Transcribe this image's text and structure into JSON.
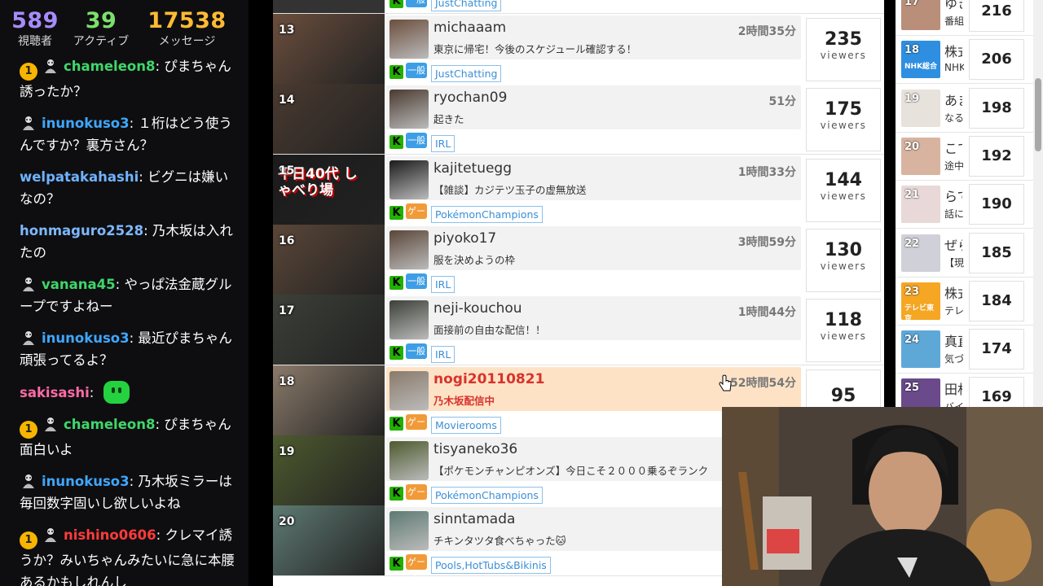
{
  "stats": [
    {
      "value": "589",
      "label": "視聴者",
      "color": "#a78bff"
    },
    {
      "value": "39",
      "label": "アクティブ",
      "color": "#7be06b"
    },
    {
      "value": "17538",
      "label": "メッセージ",
      "color": "#ffbb33"
    }
  ],
  "chat": [
    {
      "badge": "1",
      "mod": true,
      "user": "chameleon8",
      "user_color": "#3fd66b",
      "text": "ぴまちゃん誘ったか？"
    },
    {
      "badge": "",
      "mod": true,
      "user": "inunokuso3",
      "user_color": "#3fa7ff",
      "text": "１桁はどう使うんですか？裏方さん？"
    },
    {
      "badge": "",
      "mod": false,
      "user": "welpatakahashi",
      "user_color": "#6fb3ff",
      "text": "ビグニは嫌いなの？"
    },
    {
      "badge": "",
      "mod": false,
      "user": "honmaguro2528",
      "user_color": "#7db8ff",
      "text": "乃木坂は入れたの"
    },
    {
      "badge": "",
      "mod": true,
      "user": "vanana45",
      "user_color": "#3fd66b",
      "text": "やっぱ法金蔵グループですよねー"
    },
    {
      "badge": "",
      "mod": true,
      "user": "inunokuso3",
      "user_color": "#3fa7ff",
      "text": "最近ぴまちゃん頑張ってるよ？"
    },
    {
      "badge": "",
      "mod": false,
      "user": "sakisashi",
      "user_color": "#ff6ba6",
      "text": "",
      "emote": true
    },
    {
      "badge": "1",
      "mod": true,
      "user": "chameleon8",
      "user_color": "#3fd66b",
      "text": "ぴまちゃん面白いよ"
    },
    {
      "badge": "",
      "mod": true,
      "user": "inunokuso3",
      "user_color": "#3fa7ff",
      "text": "乃木坂ミラーは毎回数字固いし欲しいよね"
    },
    {
      "badge": "1",
      "mod": true,
      "user": "nishino0606",
      "user_color": "#ff3b3b",
      "text": "クレマイ誘うか？みいちゃんみたいに急に本腰あるかもしれんし"
    }
  ],
  "top_row": {
    "category_icon": "一般",
    "tag": "JustChatting"
  },
  "streams": [
    {
      "rank": "13",
      "name": "michaaam",
      "title": "東京に帰宅！今後のスケジュール確認する！",
      "duration": "2時間35分",
      "category_icon": "一般",
      "category_color": "blue",
      "tag": "JustChatting",
      "viewers": "235",
      "viewers_label": "viewers",
      "live": false,
      "thumb_color": "#6b4e3d"
    },
    {
      "rank": "14",
      "name": "ryochan09",
      "title": "起きた",
      "duration": "51分",
      "category_icon": "一般",
      "category_color": "blue",
      "tag": "IRL",
      "viewers": "175",
      "viewers_label": "viewers",
      "live": false,
      "thumb_color": "#4a3a30"
    },
    {
      "rank": "15",
      "name": "kajitetuegg",
      "title": "【雑談】カジテツ玉子の虚無放送",
      "duration": "1時間33分",
      "category_icon": "ゲーム",
      "category_color": "orange",
      "tag": "PokémonChampions",
      "viewers": "144",
      "viewers_label": "viewers",
      "live": false,
      "thumb_color": "#1b1b1b",
      "thumb_text": "平日40代 しゃべり場"
    },
    {
      "rank": "16",
      "name": "piyoko17",
      "title": "服を決めようの枠",
      "duration": "3時間59分",
      "category_icon": "一般",
      "category_color": "blue",
      "tag": "IRL",
      "viewers": "130",
      "viewers_label": "viewers",
      "live": false,
      "thumb_color": "#5a4638"
    },
    {
      "rank": "17",
      "name": "neji-kouchou",
      "title": "面接前の自由な配信！！",
      "duration": "1時間44分",
      "category_icon": "一般",
      "category_color": "blue",
      "tag": "IRL",
      "viewers": "118",
      "viewers_label": "viewers",
      "live": false,
      "thumb_color": "#3c4038"
    },
    {
      "rank": "18",
      "name": "nogi20110821",
      "title": "乃木坂配信中",
      "duration": "52時間54分",
      "category_icon": "ゲーム",
      "category_color": "orange",
      "tag": "Movierooms",
      "viewers": "95",
      "viewers_label": "",
      "live": true,
      "thumb_color": "#8a7a6a"
    },
    {
      "rank": "19",
      "name": "tisyaneko36",
      "title": "【ポケモンチャンピオンズ】今日こそ２０００乗るぞランク",
      "duration": "",
      "category_icon": "ゲーム",
      "category_color": "orange",
      "tag": "PokémonChampions",
      "viewers": "",
      "viewers_label": "",
      "live": false,
      "thumb_color": "#4d5a2e"
    },
    {
      "rank": "20",
      "name": "sinntamada",
      "title": "チキンタツタ食べちゃった🐱",
      "duration": "",
      "category_icon": "ゲーム",
      "category_color": "orange",
      "tag": "Pools,HotTubs&Bikinis",
      "viewers": "",
      "viewers_label": "",
      "live": false,
      "thumb_color": "#5e7a72"
    }
  ],
  "side": [
    {
      "rank": "17",
      "name": "ゆき",
      "sub": "番組",
      "viewers": "216",
      "color": "#b98f7a"
    },
    {
      "rank": "18",
      "name": "株式",
      "sub": "NHK",
      "viewers": "206",
      "color": "#2e8fe0",
      "thumb_label": "NHK総合"
    },
    {
      "rank": "19",
      "name": "あま",
      "sub": "なる",
      "viewers": "198",
      "color": "#e8e2dc"
    },
    {
      "rank": "20",
      "name": "こて",
      "sub": "途中",
      "viewers": "192",
      "color": "#d8b4a0"
    },
    {
      "rank": "21",
      "name": "らて",
      "sub": "話に",
      "viewers": "190",
      "color": "#e8d8d8"
    },
    {
      "rank": "22",
      "name": "ぜら",
      "sub": "【現",
      "viewers": "185",
      "color": "#d0d0d8"
    },
    {
      "rank": "23",
      "name": "株式",
      "sub": "テレ",
      "viewers": "184",
      "color": "#f5a623",
      "thumb_label": "テレビ東京"
    },
    {
      "rank": "24",
      "name": "真直",
      "sub": "気づ",
      "viewers": "174",
      "color": "#5ea8d8"
    },
    {
      "rank": "25",
      "name": "田村",
      "sub": "バイ",
      "viewers": "169",
      "color": "#6a4a8a"
    }
  ]
}
